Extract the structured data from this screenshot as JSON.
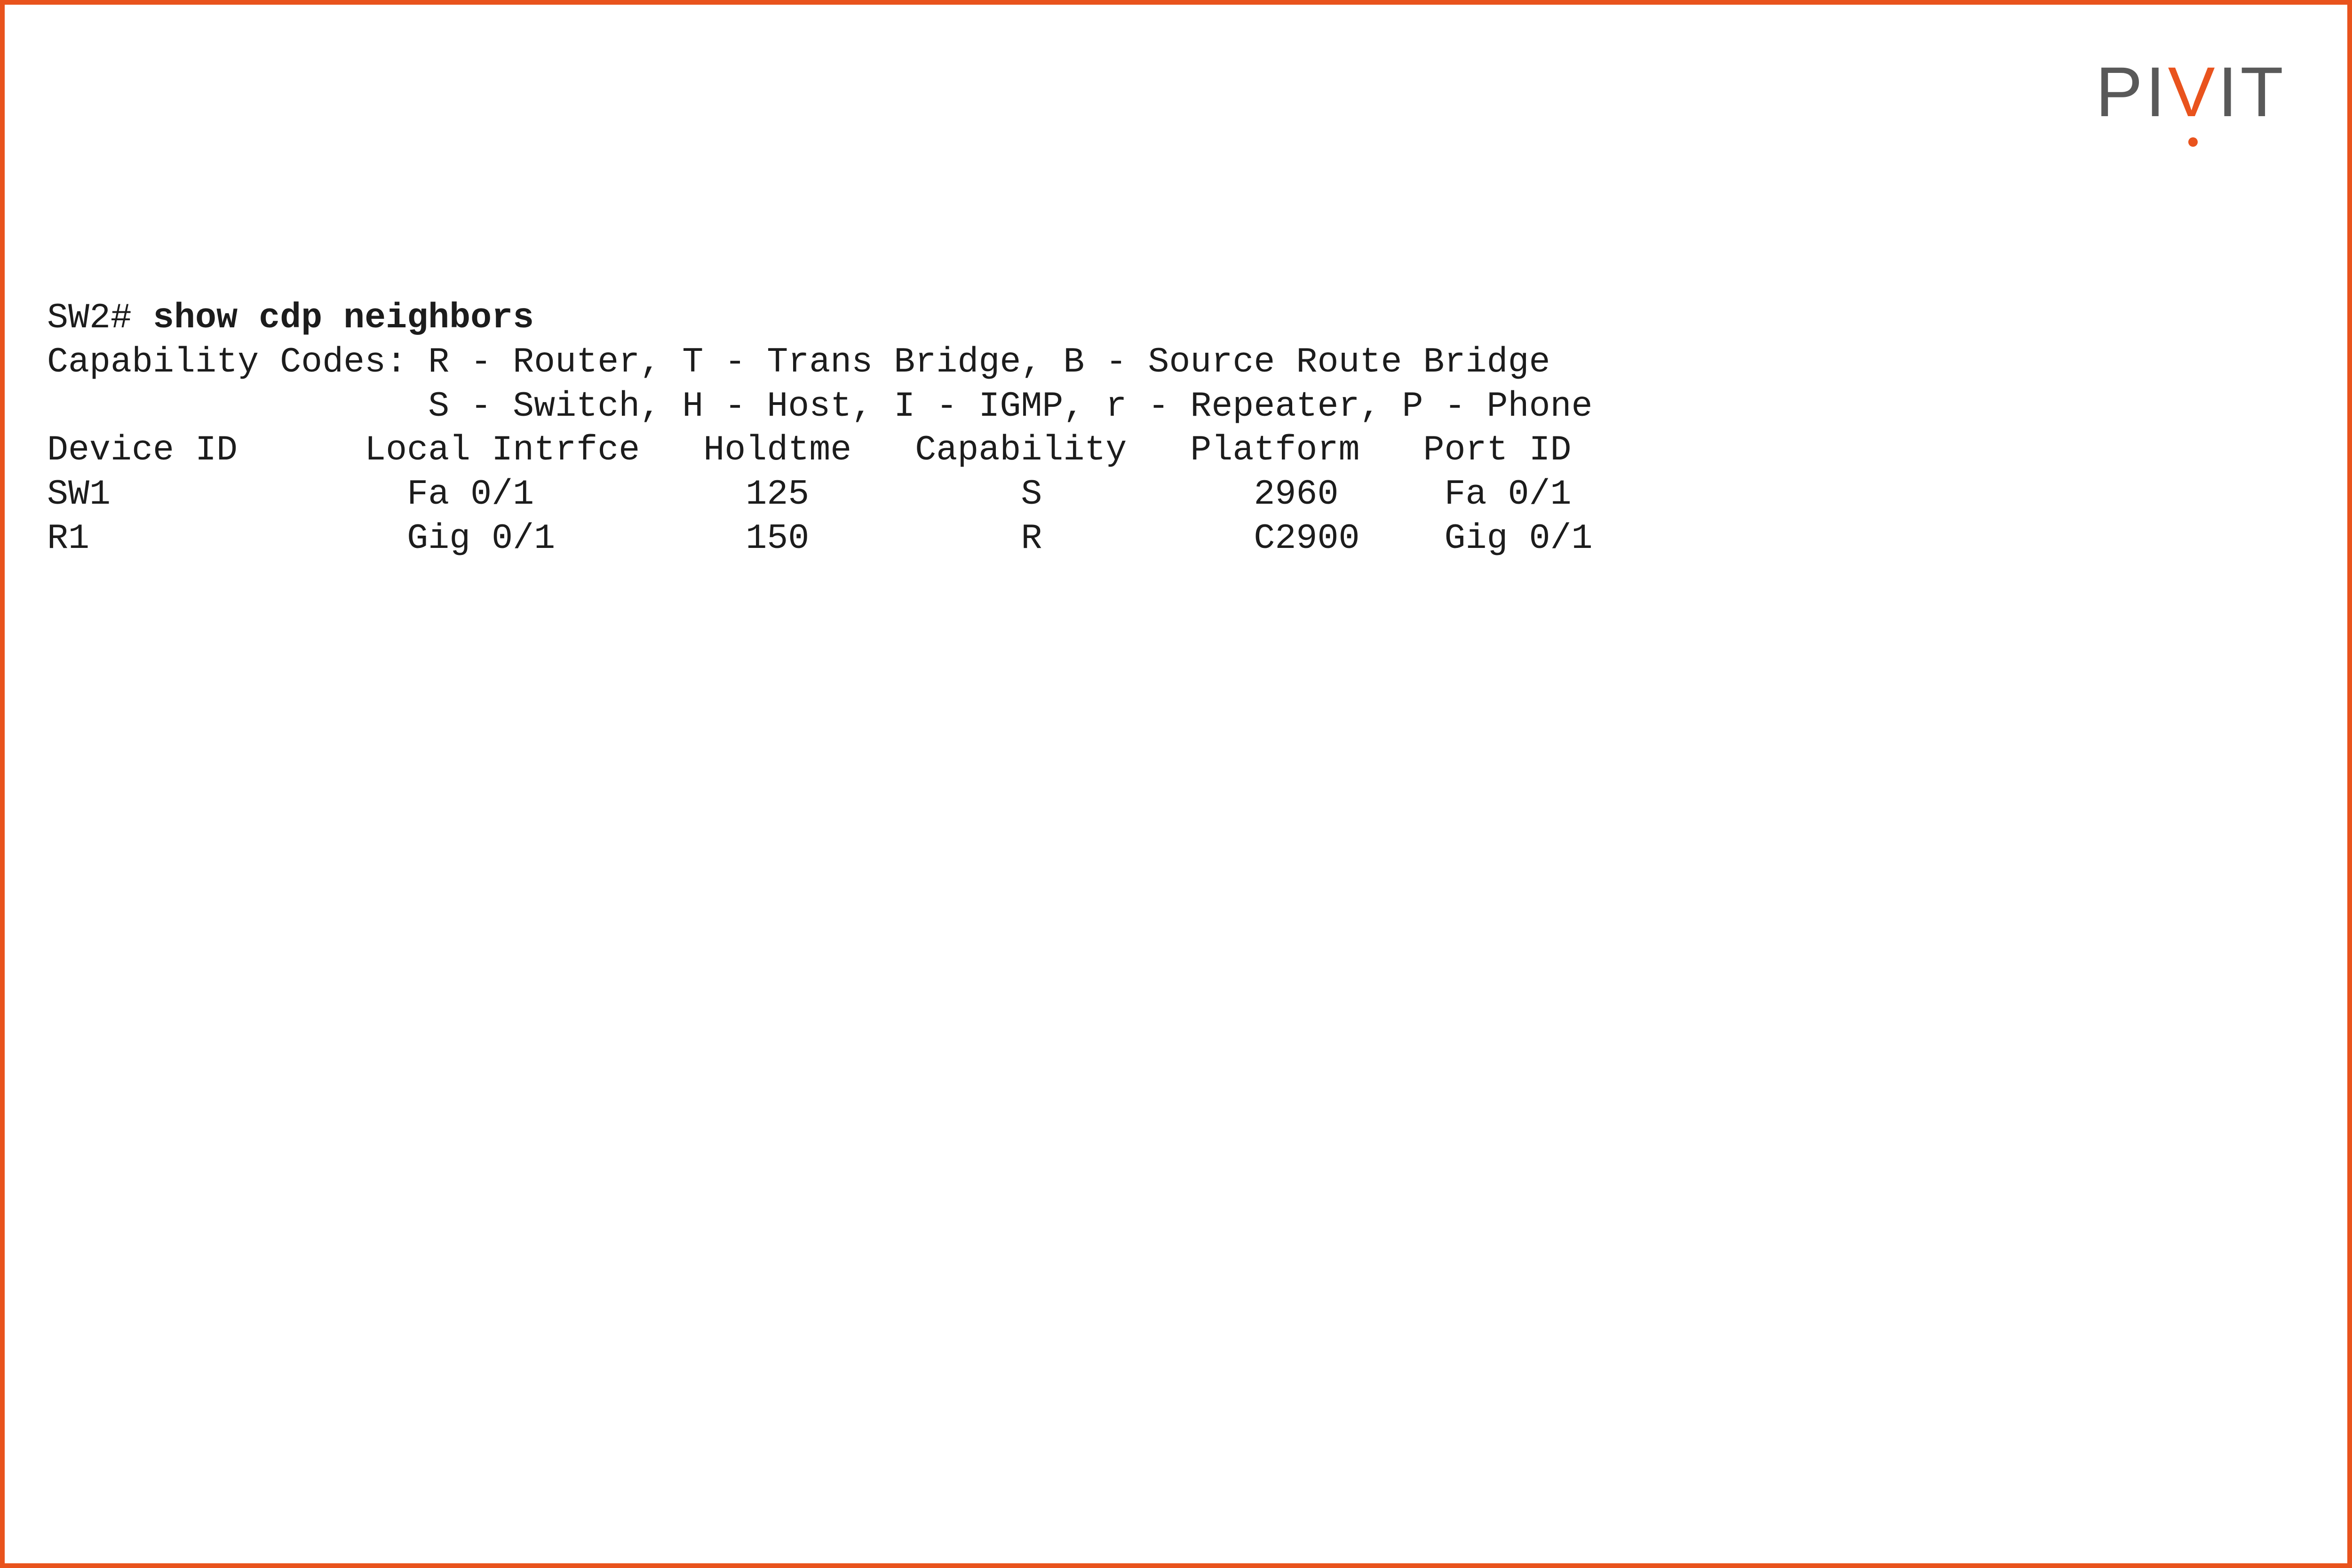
{
  "brand": {
    "p1": "PI",
    "accent": "V",
    "p2": "IT"
  },
  "cli": {
    "prompt": "SW2# ",
    "command": "show cdp neighbors",
    "codes_line1": "Capability Codes: R - Router, T - Trans Bridge, B - Source Route Bridge",
    "codes_line2": "                  S - Switch, H - Host, I - IGMP, r - Repeater, P - Phone",
    "header": "Device ID      Local Intrfce   Holdtme   Capability   Platform   Port ID",
    "row1": "SW1              Fa 0/1          125          S          2960     Fa 0/1",
    "row2": "R1               Gig 0/1         150          R          C2900    Gig 0/1"
  }
}
